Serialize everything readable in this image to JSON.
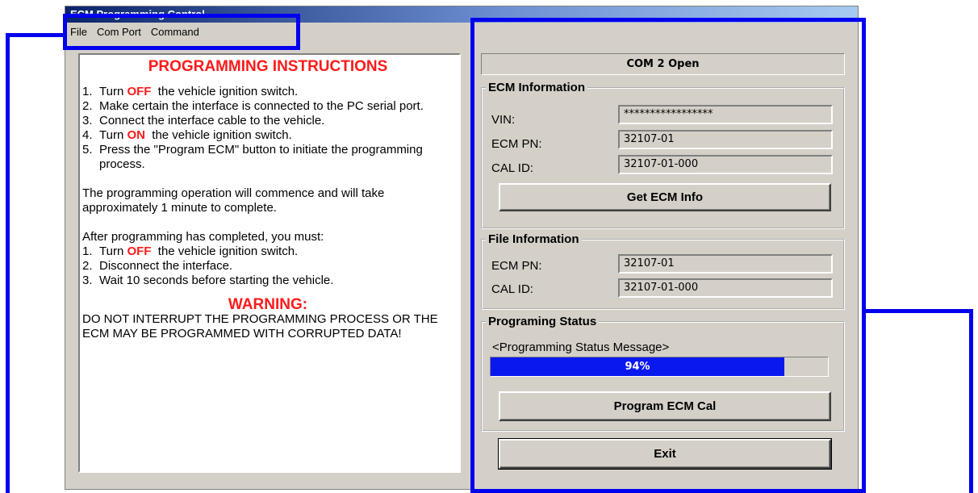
{
  "window": {
    "title": "ECM Programming Control"
  },
  "menu": {
    "items": [
      "File",
      "Com Port",
      "Command"
    ]
  },
  "instructions": {
    "heading": "PROGRAMMING INSTRUCTIONS",
    "steps": [
      {
        "n": "1.",
        "pre": "Turn ",
        "kw": "OFF",
        "post": "  the vehicle ignition switch."
      },
      {
        "n": "2.",
        "text": "Make certain the interface is connected to the PC serial port."
      },
      {
        "n": "3.",
        "text": "Connect the interface cable to the vehicle."
      },
      {
        "n": "4.",
        "pre": "Turn ",
        "kw": "ON",
        "post": "  the vehicle ignition switch."
      },
      {
        "n": "5.",
        "text": "Press the \"Program ECM\" button to initiate the programming process."
      }
    ],
    "para": "The programming operation will commence and will take approximately 1 minute to complete.",
    "after_heading": "After programming has completed, you must:",
    "after_steps": [
      {
        "n": "1.",
        "pre": "Turn ",
        "kw": "OFF",
        "post": "  the vehicle ignition switch."
      },
      {
        "n": "2.",
        "text": "Disconnect the interface."
      },
      {
        "n": "3.",
        "text": "Wait 10 seconds before starting the vehicle."
      }
    ],
    "warning_heading": "WARNING:",
    "warning_text": "DO NOT INTERRUPT THE PROGRAMMING PROCESS OR THE ECM MAY BE PROGRAMMED WITH CORRUPTED DATA!"
  },
  "status": {
    "com": "COM 2 Open"
  },
  "ecm_info": {
    "legend": "ECM Information",
    "vin_label": "VIN:",
    "vin_value": "*****************",
    "pn_label": "ECM PN:",
    "pn_value": "32107-01",
    "cal_label": "CAL ID:",
    "cal_value": "32107-01-000",
    "button": "Get ECM Info"
  },
  "file_info": {
    "legend": "File Information",
    "pn_label": "ECM PN:",
    "pn_value": "32107-01",
    "cal_label": "CAL ID:",
    "cal_value": "32107-01-000"
  },
  "prog_status": {
    "legend": "Programing Status",
    "message": "<Programming Status Message>",
    "progress": 0.87,
    "percent_label": "94%",
    "button": "Program ECM Cal"
  },
  "exit_button": "Exit",
  "colors": {
    "annotation": "#0000ee",
    "warning_red": "#ff1a1a",
    "progress_fill": "#0a18f0"
  }
}
